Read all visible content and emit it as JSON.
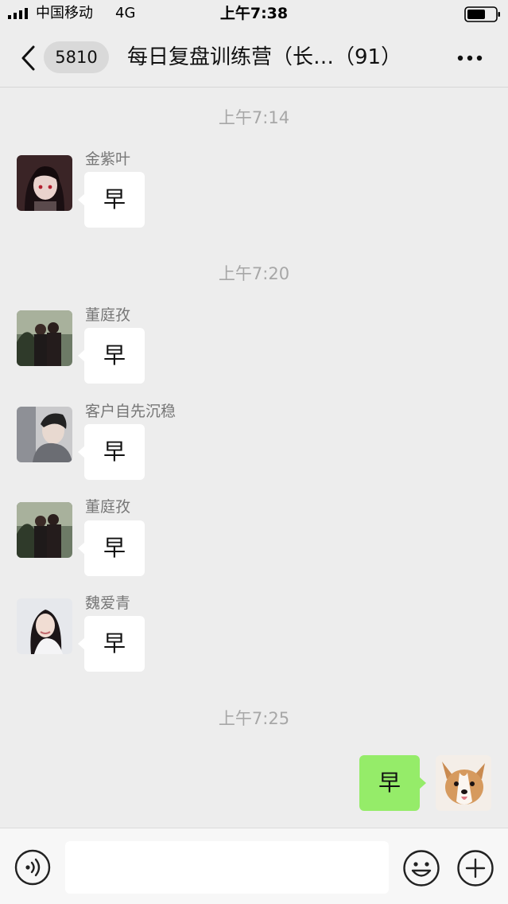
{
  "status_bar": {
    "carrier": "中国移动",
    "network": "4G",
    "time": "上午7:38",
    "icons": [
      "signal-icon",
      "battery-icon"
    ]
  },
  "nav": {
    "unread_count": "5810",
    "title": "每日复盘训练营（长…（91）",
    "icons": [
      "back-icon",
      "more-icon"
    ]
  },
  "messages": {
    "time_1": "上午7:14",
    "time_2": "上午7:20",
    "time_3": "上午7:25",
    "m1": {
      "sender": "金紫叶",
      "text": "早"
    },
    "m2": {
      "sender": "董庭孜",
      "text": "早"
    },
    "m3": {
      "sender": "客户自先沉稳",
      "text": "早"
    },
    "m4": {
      "sender": "董庭孜",
      "text": "早"
    },
    "m5": {
      "sender": "魏爱青",
      "text": "早"
    },
    "m6": {
      "text": "早"
    }
  },
  "input_bar": {
    "placeholder": "",
    "icons": [
      "voice-icon",
      "emoji-icon",
      "plus-icon"
    ]
  },
  "colors": {
    "background": "#ededed",
    "incoming_bubble": "#ffffff",
    "outgoing_bubble": "#95ec69",
    "timestamp": "#a7a7a7",
    "sender_name": "#777777"
  }
}
